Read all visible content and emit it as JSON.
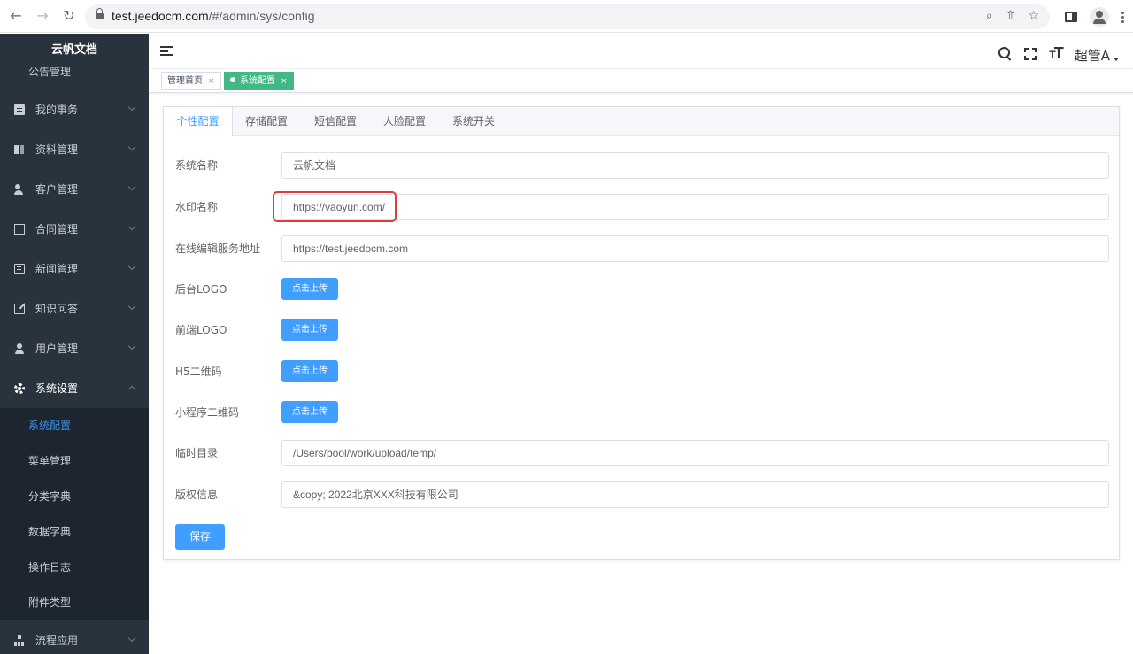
{
  "browser": {
    "url_host": "test.jeedocm.com",
    "url_path": "/#/admin/sys/config"
  },
  "sidebar": {
    "brand": "云帆文档",
    "clipped_item": "公告管理",
    "items": [
      {
        "label": "我的事务",
        "icon": "document-icon"
      },
      {
        "label": "资料管理",
        "icon": "book-icon"
      },
      {
        "label": "客户管理",
        "icon": "users-icon"
      },
      {
        "label": "合同管理",
        "icon": "contract-icon"
      },
      {
        "label": "新闻管理",
        "icon": "news-icon"
      },
      {
        "label": "知识问答",
        "icon": "edit-icon"
      },
      {
        "label": "用户管理",
        "icon": "user-icon"
      },
      {
        "label": "系统设置",
        "icon": "gear-icon",
        "expanded": true
      }
    ],
    "sub_items": [
      {
        "label": "系统配置",
        "active": true
      },
      {
        "label": "菜单管理"
      },
      {
        "label": "分类字典"
      },
      {
        "label": "数据字典"
      },
      {
        "label": "操作日志"
      },
      {
        "label": "附件类型"
      }
    ],
    "bottom_item": {
      "label": "流程应用",
      "icon": "flow-icon"
    }
  },
  "header": {
    "user_name": "超管A",
    "fontsize_icon_text": "T"
  },
  "tags": [
    {
      "label": "管理首页",
      "close": "×",
      "active": false
    },
    {
      "label": "系统配置",
      "close": "×",
      "active": true
    }
  ],
  "tabs": [
    "个性配置",
    "存储配置",
    "短信配置",
    "人脸配置",
    "系统开关"
  ],
  "active_tab": "个性配置",
  "form": {
    "system_name": {
      "label": "系统名称",
      "value": "云帆文档"
    },
    "watermark_name": {
      "label": "水印名称",
      "value": "https://vaoyun.com/"
    },
    "online_edit_url": {
      "label": "在线编辑服务地址",
      "value": "https://test.jeedocm.com"
    },
    "admin_logo": {
      "label": "后台LOGO",
      "button": "点击上传"
    },
    "front_logo": {
      "label": "前端LOGO",
      "button": "点击上传"
    },
    "h5_qrcode": {
      "label": "H5二维码",
      "button": "点击上传"
    },
    "miniapp_qrcode": {
      "label": "小程序二维码",
      "button": "点击上传"
    },
    "temp_dir": {
      "label": "临时目录",
      "value": "/Users/bool/work/upload/temp/"
    },
    "copyright": {
      "label": "版权信息",
      "value": "&copy; 2022北京XXX科技有限公司"
    },
    "save_label": "保存"
  },
  "colors": {
    "sidebar_bg": "#28333e",
    "submenu_bg": "#1d252e",
    "primary": "#409eff",
    "tag_active": "#42b983",
    "highlight": "#e23b3b"
  }
}
